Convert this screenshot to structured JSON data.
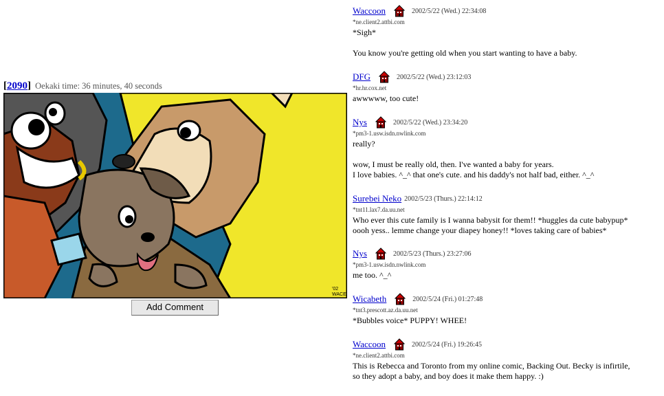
{
  "post": {
    "bracket_open": "[",
    "id": "2090",
    "bracket_close": "]",
    "time_label": "Oekaki time: 36 minutes, 40 seconds",
    "signature": "'02\nWACE"
  },
  "add_comment_label": "Add Comment",
  "colors": {
    "link": "#0000cc",
    "house_roof": "#cc0000",
    "house_body": "#8a0000"
  },
  "comments": [
    {
      "name": "Waccoon",
      "date": "2002/5/22 (Wed.) 22:34:08",
      "host": "*ne.client2.attbi.com",
      "lines": [
        "*Sigh*",
        "",
        "You know you're getting old when you start wanting to have a baby."
      ]
    },
    {
      "name": "DFG",
      "date": "2002/5/22 (Wed.) 23:12:03",
      "host": "*hr.hr.cox.net",
      "lines": [
        "awwwww, too cute!"
      ]
    },
    {
      "name": "Nys",
      "date": "2002/5/22 (Wed.) 23:34:20",
      "host": "*pm3-1.usw.isdn.nwlink.com",
      "lines": [
        "really?",
        "",
        "wow, I must be really old, then. I've wanted a baby for years.",
        "I love babies. ^_^ that one's cute. and his daddy's not half bad, either. ^_^"
      ]
    },
    {
      "name": "Surebei Neko",
      "date": "2002/5/23 (Thurs.) 22:14:12",
      "host": "*tnt11.lax7.da.uu.net",
      "lines": [
        "Who ever this cute family is I wanna babysit for them!! *huggles da cute babypup*",
        "oooh yess.. lemme change your diapey honey!! *loves taking care of babies*"
      ]
    },
    {
      "name": "Nys",
      "date": "2002/5/23 (Thurs.) 23:27:06",
      "host": "*pm3-1.usw.isdn.nwlink.com",
      "lines": [
        "me too. ^_^"
      ]
    },
    {
      "name": "Wicabeth",
      "date": "2002/5/24 (Fri.) 01:27:48",
      "host": "*tnt3.prescott.az.da.uu.net",
      "lines": [
        "*Bubbles voice* PUPPY! WHEE!"
      ]
    },
    {
      "name": "Waccoon",
      "date": "2002/5/24 (Fri.) 19:26:45",
      "host": "*ne.client2.attbi.com",
      "lines": [
        "This is Rebecca and Toronto from my online comic, Backing Out. Becky is infirtile,",
        "so they adopt a baby, and boy does it make them happy. :)"
      ]
    }
  ]
}
